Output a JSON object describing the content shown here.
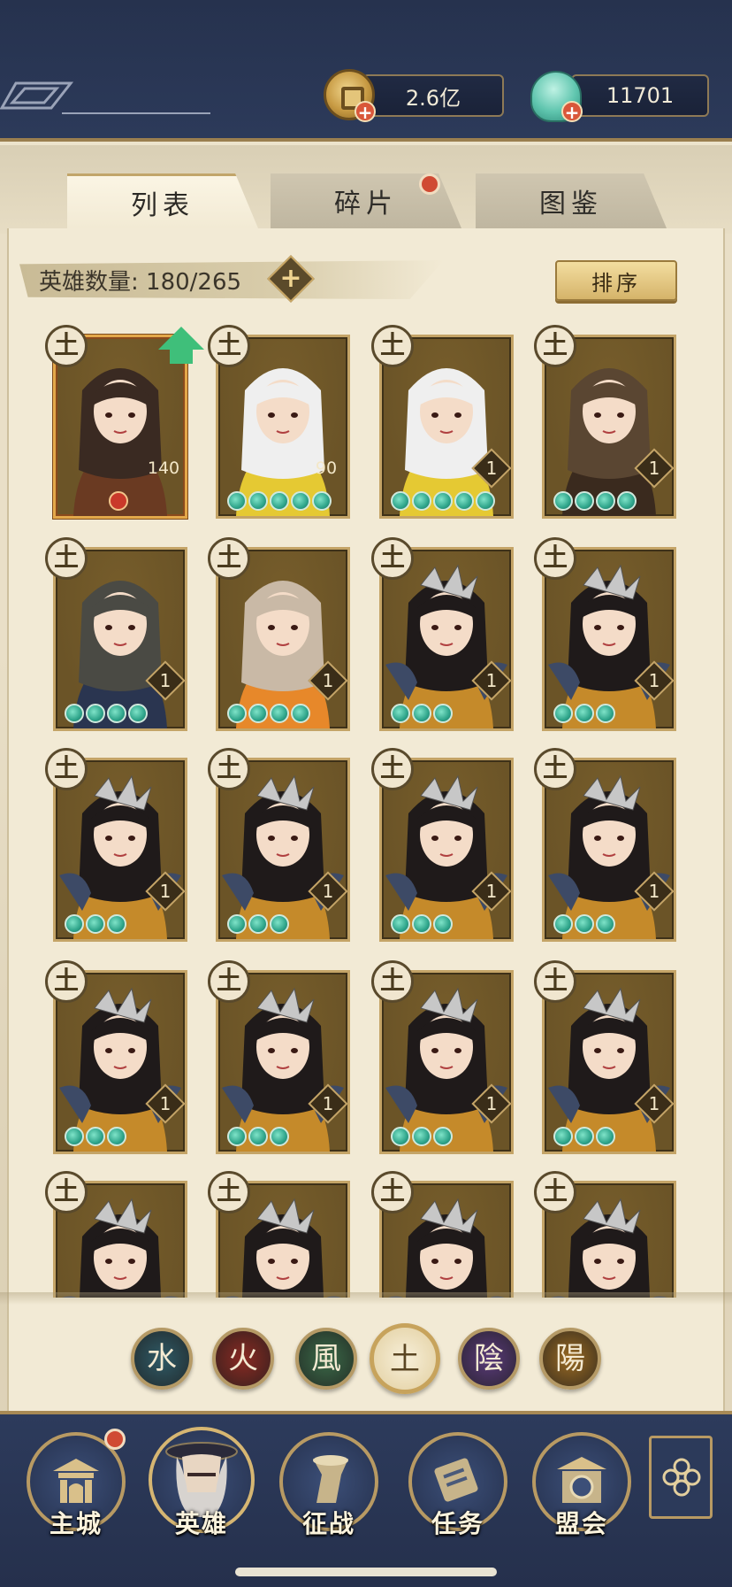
{
  "currency": {
    "coins": "2.6亿",
    "shells": "11701",
    "coin_icon": "copper-coin-icon",
    "shell_icon": "jade-shell-icon"
  },
  "tabs": [
    {
      "label": "列表",
      "active": true
    },
    {
      "label": "碎片",
      "active": false,
      "has_notification": true
    },
    {
      "label": "图鉴",
      "active": false
    }
  ],
  "hero_count": {
    "label": "英雄数量: 180/265"
  },
  "sort_label": "排序",
  "heroes": [
    {
      "element": "土",
      "level": "140",
      "stars": 0,
      "upgradeable": true
    },
    {
      "element": "土",
      "level": "90",
      "stars": 5
    },
    {
      "element": "土",
      "level": "1",
      "stars": 5
    },
    {
      "element": "土",
      "level": "1",
      "stars": 4
    },
    {
      "element": "土",
      "level": "1",
      "stars": 4
    },
    {
      "element": "土",
      "level": "1",
      "stars": 4
    },
    {
      "element": "土",
      "level": "1",
      "stars": 3
    },
    {
      "element": "土",
      "level": "1",
      "stars": 3
    },
    {
      "element": "土",
      "level": "1",
      "stars": 3
    },
    {
      "element": "土",
      "level": "1",
      "stars": 3
    },
    {
      "element": "土",
      "level": "1",
      "stars": 3
    },
    {
      "element": "土",
      "level": "1",
      "stars": 3
    },
    {
      "element": "土",
      "level": "1",
      "stars": 3
    },
    {
      "element": "土",
      "level": "1",
      "stars": 3
    },
    {
      "element": "土",
      "level": "1",
      "stars": 3
    },
    {
      "element": "土",
      "level": "1",
      "stars": 3
    },
    {
      "element": "土",
      "level": "",
      "stars": 0
    },
    {
      "element": "土",
      "level": "",
      "stars": 0
    },
    {
      "element": "土",
      "level": "",
      "stars": 0
    },
    {
      "element": "土",
      "level": "",
      "stars": 0
    }
  ],
  "element_filters": [
    {
      "glyph": "水",
      "color": "#2f5a66",
      "active": false
    },
    {
      "glyph": "火",
      "color": "#8a2a22",
      "active": false
    },
    {
      "glyph": "風",
      "color": "#3b6a48",
      "active": false
    },
    {
      "glyph": "土",
      "color": "#e6d3a3",
      "active": true
    },
    {
      "glyph": "陰",
      "color": "#5a3a7a",
      "active": false
    },
    {
      "glyph": "陽",
      "color": "#9a6a22",
      "active": false
    }
  ],
  "nav": [
    {
      "label": "主城",
      "icon": "palace-gate-icon",
      "has_notification": true
    },
    {
      "label": "英雄",
      "icon": "hero-portrait-icon",
      "active": true
    },
    {
      "label": "征战",
      "icon": "war-drum-icon"
    },
    {
      "label": "任务",
      "icon": "scroll-quest-icon"
    },
    {
      "label": "盟会",
      "icon": "alliance-pavilion-icon"
    }
  ],
  "more_icon": "flower-menu-icon"
}
